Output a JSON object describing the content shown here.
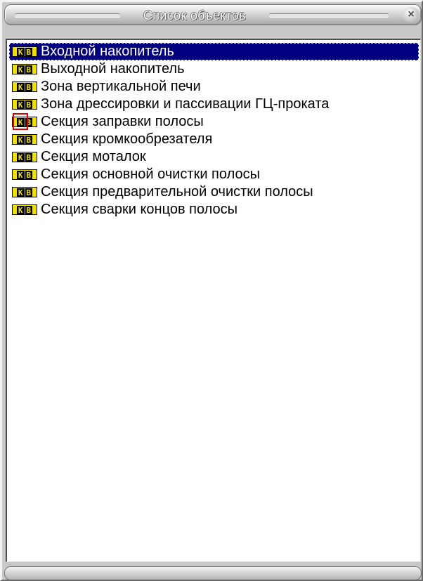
{
  "window": {
    "title": "Список объектов",
    "close_glyph": "×"
  },
  "list": {
    "icon_letters": [
      "К",
      "В"
    ],
    "items": [
      {
        "label": "Входной накопитель",
        "selected": true,
        "marked": false
      },
      {
        "label": "Выходной накопитель",
        "selected": false,
        "marked": false
      },
      {
        "label": "Зона вертикальной печи",
        "selected": false,
        "marked": false
      },
      {
        "label": "Зона дрессировки и пассивации ГЦ-проката",
        "selected": false,
        "marked": false
      },
      {
        "label": "Секция заправки полосы",
        "selected": false,
        "marked": true
      },
      {
        "label": "Секция кромкообрезателя",
        "selected": false,
        "marked": false
      },
      {
        "label": "Секция моталок",
        "selected": false,
        "marked": false
      },
      {
        "label": "Секция основной очистки полосы",
        "selected": false,
        "marked": false
      },
      {
        "label": "Секция предварительной очистки полосы",
        "selected": false,
        "marked": false
      },
      {
        "label": "Секция сварки концов полосы",
        "selected": false,
        "marked": false
      }
    ]
  },
  "colors": {
    "selection_bg": "#000080",
    "icon_yellow": "#f0e000",
    "marker_red": "#e00000",
    "window_gray": "#c8c8c8"
  }
}
